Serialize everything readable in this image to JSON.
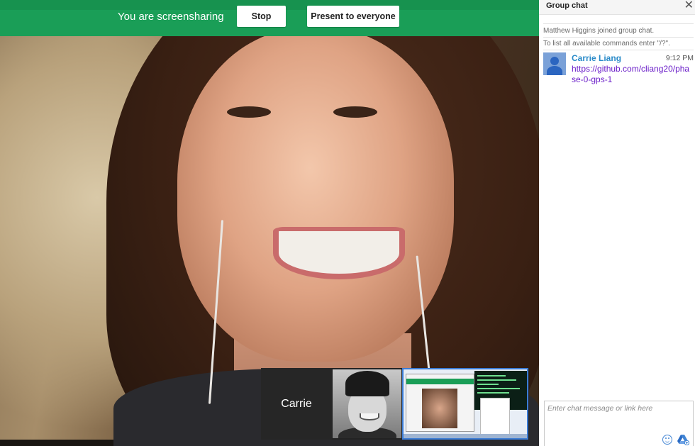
{
  "banner": {
    "status_text": "You are screensharing",
    "stop_label": "Stop",
    "present_label": "Present to everyone",
    "color": "#1a9e57"
  },
  "filmstrip": {
    "participant_name": "Carrie"
  },
  "chat": {
    "title": "Group chat",
    "close_icon": "close-icon",
    "notices": [
      "Matthew Higgins joined group chat.",
      "To list all available commands enter \"/?\"."
    ],
    "messages": [
      {
        "author": "Carrie Liang",
        "time": "9:12 PM",
        "text": "https://github.com/cliang20/phase-0-gps-1",
        "author_color": "#2a8bc9",
        "link_color": "#6b1ec9"
      }
    ],
    "input_placeholder": "Enter chat message or link here",
    "icons": [
      "emoji-icon",
      "drive-icon"
    ]
  }
}
